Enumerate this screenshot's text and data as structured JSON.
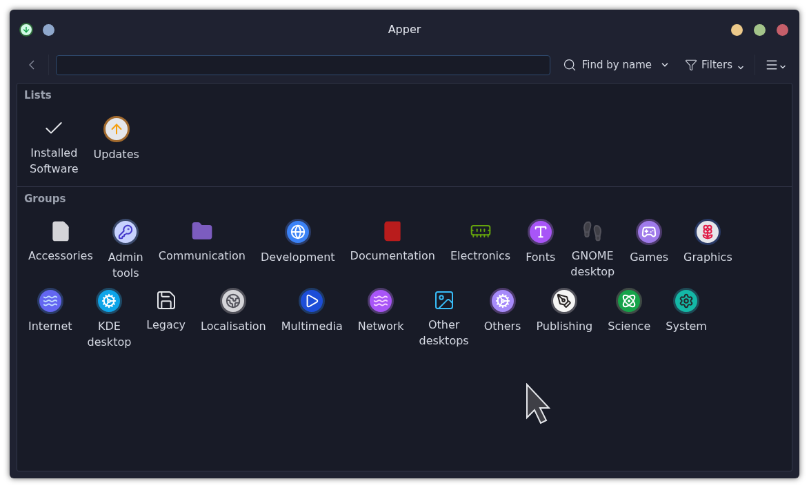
{
  "window": {
    "title": "Apper"
  },
  "toolbar": {
    "find_mode": "Find by name",
    "filters": "Filters"
  },
  "lists": {
    "heading": "Lists",
    "items": [
      {
        "label": "Installed Software"
      },
      {
        "label": "Updates"
      }
    ]
  },
  "groups": {
    "heading": "Groups",
    "items": [
      {
        "label": "Accessories"
      },
      {
        "label": "Admin tools"
      },
      {
        "label": "Communication"
      },
      {
        "label": "Development"
      },
      {
        "label": "Documentation"
      },
      {
        "label": "Electronics"
      },
      {
        "label": "Fonts"
      },
      {
        "label": "GNOME desktop"
      },
      {
        "label": "Games"
      },
      {
        "label": "Graphics"
      },
      {
        "label": "Internet"
      },
      {
        "label": "KDE desktop"
      },
      {
        "label": "Legacy"
      },
      {
        "label": "Localisation"
      },
      {
        "label": "Multimedia"
      },
      {
        "label": "Network"
      },
      {
        "label": "Other desktops"
      },
      {
        "label": "Others"
      },
      {
        "label": "Publishing"
      },
      {
        "label": "Science"
      },
      {
        "label": "System"
      }
    ]
  }
}
